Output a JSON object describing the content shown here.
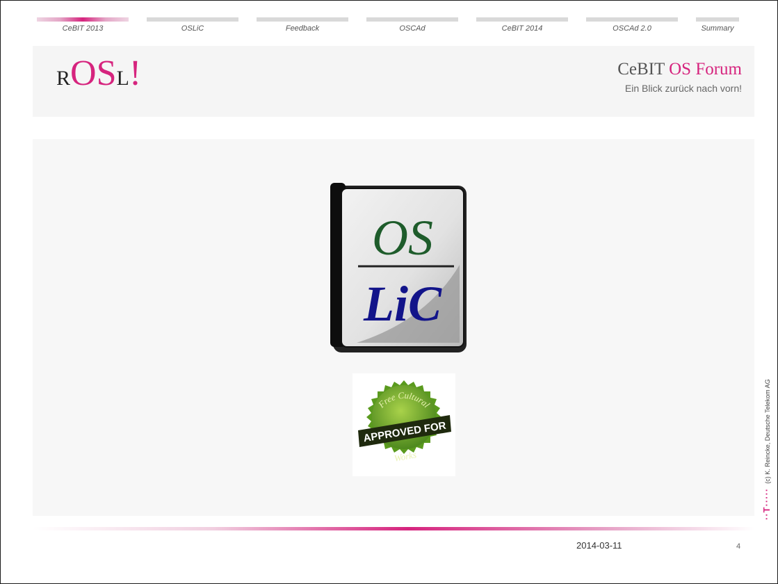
{
  "nav": {
    "items": [
      {
        "label": "CeBIT 2013",
        "active": true
      },
      {
        "label": "OSLiC",
        "active": false
      },
      {
        "label": "Feedback",
        "active": false
      },
      {
        "label": "OSCAd",
        "active": false
      },
      {
        "label": "CeBIT 2014",
        "active": false
      },
      {
        "label": "OSCAd 2.0",
        "active": false
      },
      {
        "label": "Summary",
        "active": false
      }
    ]
  },
  "header": {
    "logo": {
      "r": "R",
      "os": "OS",
      "l": "L",
      "bang": "!"
    },
    "forum_title_plain": "CeBIT ",
    "forum_title_os": "OS",
    "forum_title_forum": " Forum",
    "forum_subtitle": "Ein Blick zurück nach vorn!"
  },
  "content": {
    "book": {
      "top_text": "OS",
      "bottom_text": "LiC"
    },
    "badge": {
      "top_text": "Free Cultural",
      "ribbon_text": "APPROVED FOR",
      "bottom_text": "Works"
    }
  },
  "footer": {
    "date": "2014-03-11",
    "page_number": "4"
  },
  "side": {
    "brand_mark": "··T·····",
    "copyright": "(c) K. Reincke, Deutsche Telekom AG"
  },
  "colors": {
    "accent": "#d6247e",
    "book_green": "#1e5c2b",
    "book_blue": "#12148a",
    "badge_green": "#5a9a1e"
  }
}
